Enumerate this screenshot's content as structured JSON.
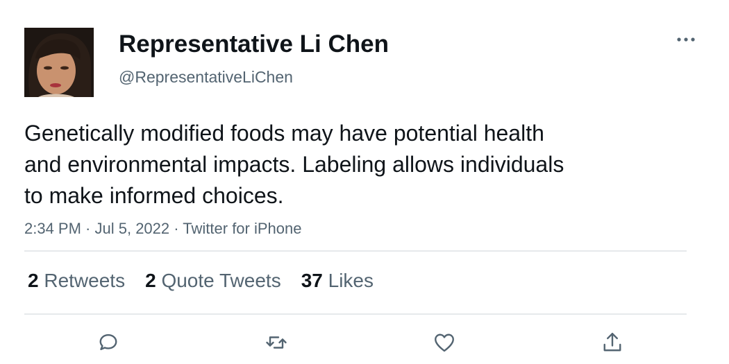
{
  "author": {
    "display_name": "Representative Li Chen",
    "handle": "@RepresentativeLiChen",
    "avatar_icon": "profile-photo"
  },
  "tweet": {
    "text": "Genetically modified foods may have potential health\nand environmental impacts. Labeling allows individuals\nto make informed choices.",
    "time": "2:34 PM",
    "date": "Jul 5, 2022",
    "source": "Twitter for iPhone",
    "separator": " · "
  },
  "stats": {
    "retweets_count": "2",
    "retweets_label": "Retweets",
    "quotes_count": "2",
    "quotes_label": "Quote Tweets",
    "likes_count": "37",
    "likes_label": "Likes"
  },
  "actions": [
    "reply-icon",
    "retweet-icon",
    "like-icon",
    "share-icon"
  ],
  "colors": {
    "text_primary": "#0f1419",
    "text_secondary": "#536471",
    "icon": "#536471",
    "divider": "#e6e9eb"
  }
}
